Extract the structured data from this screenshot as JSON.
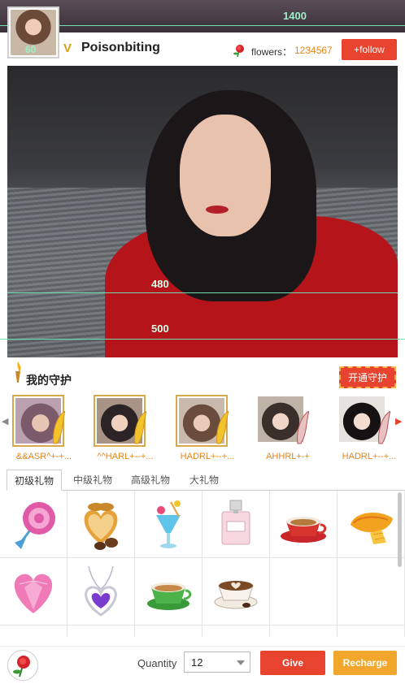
{
  "guides": {
    "top": "1400",
    "avatar": "60",
    "video_inner": "480",
    "video_outer": "500"
  },
  "profile": {
    "username": "Poisonbiting",
    "vip_badge": "V",
    "flowers_label": "flowers：",
    "flowers_count": "1234567",
    "follow_label": "+follow"
  },
  "guardians": {
    "title": "我的守护",
    "open_label": "开通守护",
    "items": [
      {
        "name": "&&ASR^+-+..."
      },
      {
        "name": "^^HARL+--+..."
      },
      {
        "name": "HADRL+--+..."
      },
      {
        "name": "AHHRL+-+"
      },
      {
        "name": "HADRL+--+..."
      }
    ]
  },
  "tabs": [
    {
      "label": "初级礼物",
      "active": true
    },
    {
      "label": "中级礼物",
      "active": false
    },
    {
      "label": "高级礼物",
      "active": false
    },
    {
      "label": "大礼物",
      "active": false
    }
  ],
  "gifts": [
    {
      "icon": "lollipop-icon"
    },
    {
      "icon": "chocolate-box-icon"
    },
    {
      "icon": "cocktail-icon"
    },
    {
      "icon": "perfume-icon"
    },
    {
      "icon": "coffee-cup-icon"
    },
    {
      "icon": "mango-icon"
    },
    {
      "icon": "pink-heart-icon"
    },
    {
      "icon": "heart-necklace-icon"
    },
    {
      "icon": "green-coffee-icon"
    },
    {
      "icon": "latte-art-icon"
    }
  ],
  "bottom": {
    "quantity_label": "Quantity",
    "quantity_value": "12",
    "give_label": "Give",
    "recharge_label": "Recharge"
  },
  "colors": {
    "accent_red": "#e8432e",
    "accent_orange": "#f0a72c",
    "name_orange": "#e8851c"
  }
}
